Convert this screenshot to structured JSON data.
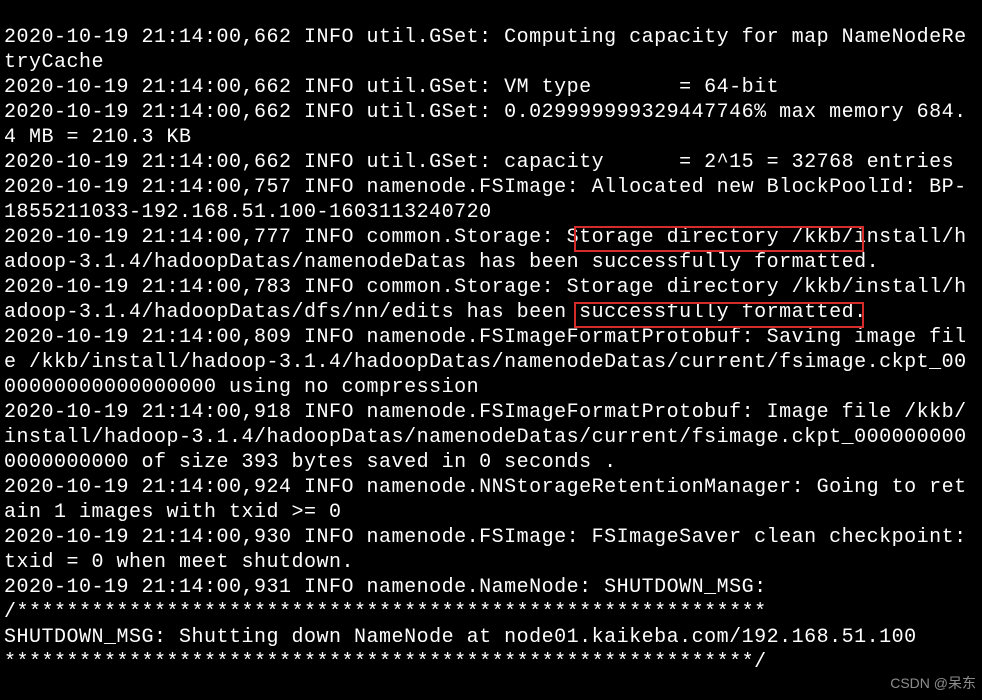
{
  "log_lines": [
    "2020-10-19 21:14:00,662 INFO util.GSet: Computing capacity for map NameNodeRetryCache",
    "2020-10-19 21:14:00,662 INFO util.GSet: VM type       = 64-bit",
    "2020-10-19 21:14:00,662 INFO util.GSet: 0.029999999329447746% max memory 684.4 MB = 210.3 KB",
    "2020-10-19 21:14:00,662 INFO util.GSet: capacity      = 2^15 = 32768 entries",
    "2020-10-19 21:14:00,757 INFO namenode.FSImage: Allocated new BlockPoolId: BP-1855211033-192.168.51.100-1603113240720",
    "2020-10-19 21:14:00,777 INFO common.Storage: Storage directory /kkb/install/hadoop-3.1.4/hadoopDatas/namenodeDatas has been successfully formatted.",
    "2020-10-19 21:14:00,783 INFO common.Storage: Storage directory /kkb/install/hadoop-3.1.4/hadoopDatas/dfs/nn/edits has been successfully formatted.",
    "2020-10-19 21:14:00,809 INFO namenode.FSImageFormatProtobuf: Saving image file /kkb/install/hadoop-3.1.4/hadoopDatas/namenodeDatas/current/fsimage.ckpt_0000000000000000000 using no compression",
    "2020-10-19 21:14:00,918 INFO namenode.FSImageFormatProtobuf: Image file /kkb/install/hadoop-3.1.4/hadoopDatas/namenodeDatas/current/fsimage.ckpt_0000000000000000000 of size 393 bytes saved in 0 seconds .",
    "2020-10-19 21:14:00,924 INFO namenode.NNStorageRetentionManager: Going to retain 1 images with txid >= 0",
    "2020-10-19 21:14:00,930 INFO namenode.FSImage: FSImageSaver clean checkpoint: txid = 0 when meet shutdown.",
    "2020-10-19 21:14:00,931 INFO namenode.NameNode: SHUTDOWN_MSG:",
    "/************************************************************",
    "SHUTDOWN_MSG: Shutting down NameNode at node01.kaikeba.com/192.168.51.100",
    "************************************************************/"
  ],
  "highlight_text_1": "has been successfully",
  "highlight_text_2": "has been successfully",
  "watermark": "CSDN @呆东",
  "colors": {
    "background": "#000000",
    "foreground": "#FFFFFF",
    "highlight_border": "#d52b2b"
  }
}
